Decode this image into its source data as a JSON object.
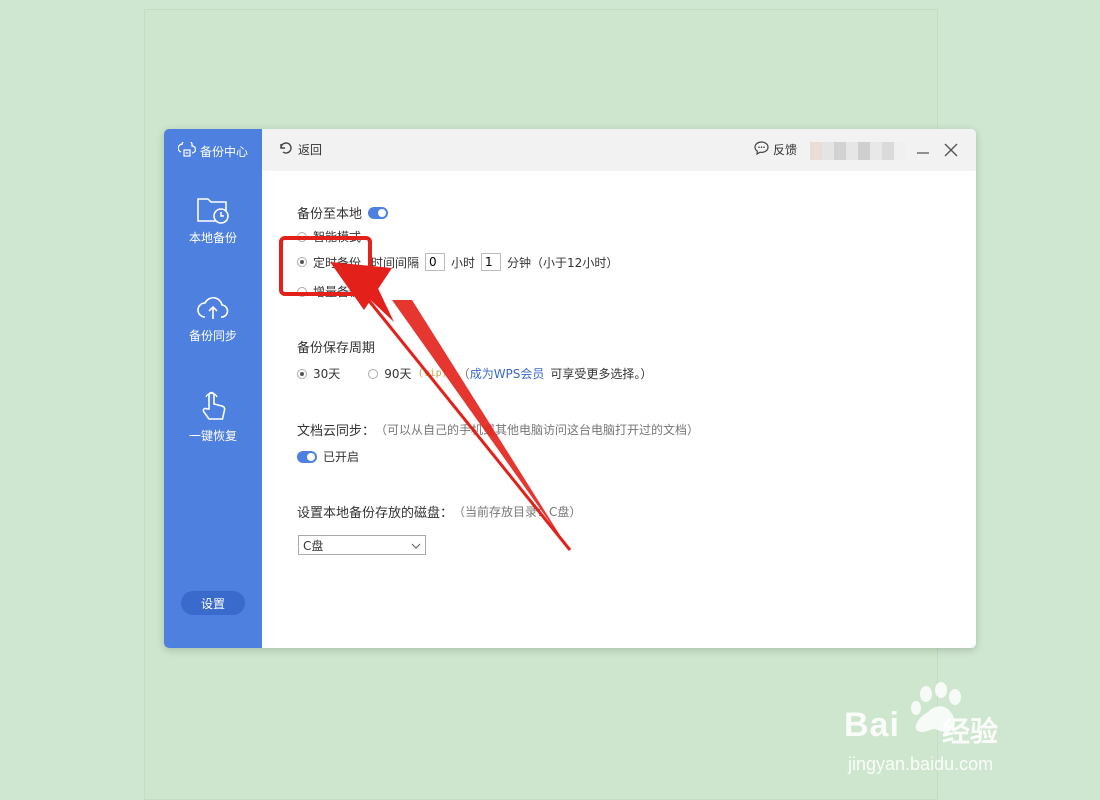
{
  "sidebar": {
    "header": "备份中心",
    "items": [
      {
        "label": "本地备份",
        "icon": "folder-clock-icon"
      },
      {
        "label": "备份同步",
        "icon": "cloud-upload-icon"
      },
      {
        "label": "一键恢复",
        "icon": "hand-pointer-icon"
      }
    ],
    "settings_label": "设置"
  },
  "topbar": {
    "back_label": "返回",
    "feedback_label": "反馈"
  },
  "backup_local": {
    "title": "备份至本地",
    "mode_smart": "智能模式",
    "mode_scheduled": "定时备份",
    "interval_label": "时间间隔",
    "hours_value": "0",
    "hours_unit": "小时",
    "minutes_value": "1",
    "minutes_unit": "分钟（小于12小时）",
    "mode_incremental": "增量备份",
    "enabled": true,
    "selected_mode": "定时备份"
  },
  "retention": {
    "title": "备份保存周期",
    "option_30": "30天",
    "option_90": "90天",
    "vip_tag": "(vip)",
    "note_open": "（",
    "note_link": "成为WPS会员",
    "note_rest": " 可享受更多选择。）",
    "selected": "30天"
  },
  "cloud_sync": {
    "title": "文档云同步：",
    "hint": "（可以从自己的手机或其他电脑访问这台电脑打开过的文档）",
    "status": "已开启"
  },
  "disk": {
    "title": "设置本地备份存放的磁盘：",
    "hint": "（当前存放目录：C盘）",
    "selected": "C盘"
  },
  "watermark": {
    "brand": "Bai",
    "brand2": "经验",
    "url": "jingyan.baidu.com"
  },
  "colors": {
    "accent": "#4e80e0",
    "annotation": "#e3201a",
    "background": "#cfe6d0"
  }
}
